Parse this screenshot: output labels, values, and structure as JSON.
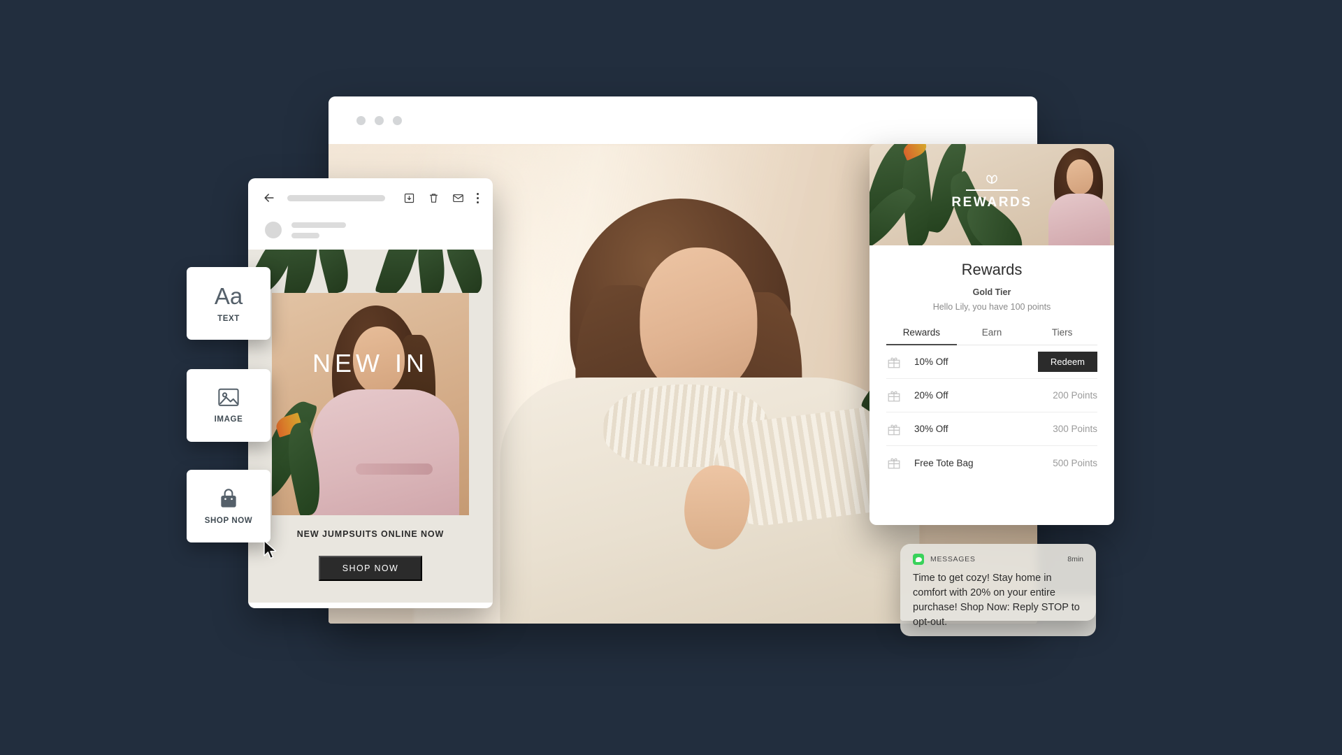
{
  "theme": {
    "background": "#222e3e",
    "accent_dark": "#2b2b2b",
    "sms_green": "#39d25a"
  },
  "browser": {
    "name": "browser-window",
    "dots": [
      "dot-1",
      "dot-2",
      "dot-3"
    ],
    "hero_alt": "fashion-model-hero-image"
  },
  "email": {
    "toolbar": {
      "back_icon": "back-arrow-icon",
      "subject_placeholder": "",
      "archive_icon": "archive-icon",
      "delete_icon": "trash-icon",
      "mail_icon": "mail-icon",
      "more_icon": "more-vertical-icon"
    },
    "overlay_title": "NEW IN",
    "caption": "NEW JUMPSUITS ONLINE NOW",
    "cta_label": "SHOP NOW"
  },
  "widgets": [
    {
      "id": "text",
      "glyph": "Aa",
      "label": "TEXT",
      "icon": "text-icon"
    },
    {
      "id": "image",
      "glyph": "",
      "label": "IMAGE",
      "icon": "image-icon"
    },
    {
      "id": "shop",
      "glyph": "",
      "label": "SHOP NOW",
      "icon": "shopping-bag-icon"
    }
  ],
  "rewards": {
    "wordmark": "REWARDS",
    "title": "Rewards",
    "tier": "Gold Tier",
    "greeting": "Hello Lily, you have 100 points",
    "tabs": [
      {
        "label": "Rewards",
        "active": true
      },
      {
        "label": "Earn",
        "active": false
      },
      {
        "label": "Tiers",
        "active": false
      }
    ],
    "rows": [
      {
        "name": "10% Off",
        "value": "",
        "action": "Redeem"
      },
      {
        "name": "20% Off",
        "value": "200 Points",
        "action": ""
      },
      {
        "name": "30% Off",
        "value": "300 Points",
        "action": ""
      },
      {
        "name": "Free Tote Bag",
        "value": "500 Points",
        "action": ""
      }
    ]
  },
  "sms": {
    "app": "MESSAGES",
    "time": "8min",
    "icon": "messages-icon",
    "text": "Time to get cozy! Stay home in comfort with 20% on your entire purchase! Shop Now: Reply STOP to opt-out."
  },
  "cursor": {
    "icon": "mouse-cursor-icon"
  }
}
